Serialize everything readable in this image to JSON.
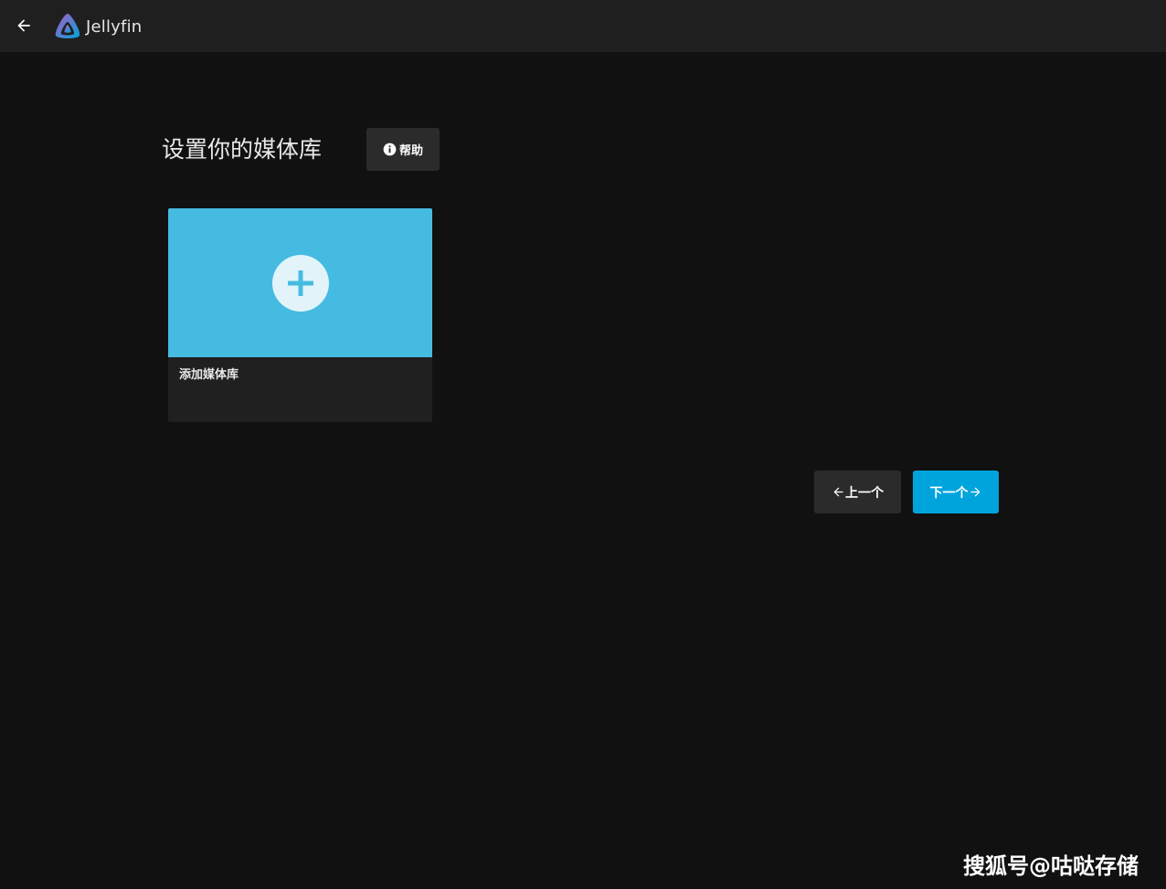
{
  "app": {
    "name": "Jellyfin",
    "accent_color": "#00a4dc"
  },
  "header": {
    "back_icon": "arrow-left-icon",
    "logo_icon": "jellyfin-logo-icon"
  },
  "main": {
    "title": "设置你的媒体库",
    "help_label": "帮助",
    "help_icon": "info-icon"
  },
  "library_card": {
    "label": "添加媒体库",
    "icon": "plus-icon",
    "image_color": "#46bbe2"
  },
  "nav": {
    "prev_label": "上一个",
    "next_label": "下一个"
  },
  "watermark": {
    "text": "搜狐号@咕哒存储"
  }
}
